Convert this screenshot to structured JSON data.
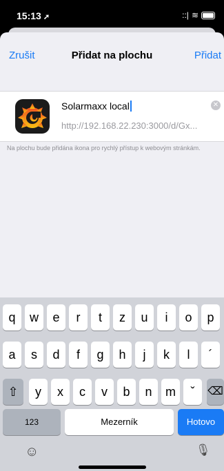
{
  "status": {
    "time": "15:13",
    "location_arrow": "➚",
    "signal": "::|",
    "wifi": "≋",
    "battery_icon": "battery"
  },
  "nav": {
    "cancel": "Zrušit",
    "title": "Přidat na plochu",
    "add": "Přidat"
  },
  "bookmark": {
    "name": "Solarmaxx local",
    "url": "http://192.168.22.230:3000/d/Gx...",
    "icon_name": "grafana-logo-icon",
    "clear_icon": "clear-text-icon"
  },
  "hint": "Na plochu bude přidána ikona pro rychlý přístup k webovým stránkám.",
  "keyboard": {
    "row1": [
      "q",
      "w",
      "e",
      "r",
      "t",
      "z",
      "u",
      "i",
      "o",
      "p"
    ],
    "row2": [
      "a",
      "s",
      "d",
      "f",
      "g",
      "h",
      "j",
      "k",
      "l",
      "´"
    ],
    "row3": [
      "y",
      "x",
      "c",
      "v",
      "b",
      "n",
      "m",
      "ˇ"
    ],
    "shift_icon": "⇧",
    "delete_icon": "⌫",
    "numbers": "123",
    "space": "Mezerník",
    "done": "Hotovo",
    "emoji_icon": "☺",
    "mic_icon": "🎙"
  },
  "colors": {
    "accent": "#1a7bf5",
    "sheet_bg": "#efeff4",
    "keyboard_bg": "#d1d3d9"
  }
}
